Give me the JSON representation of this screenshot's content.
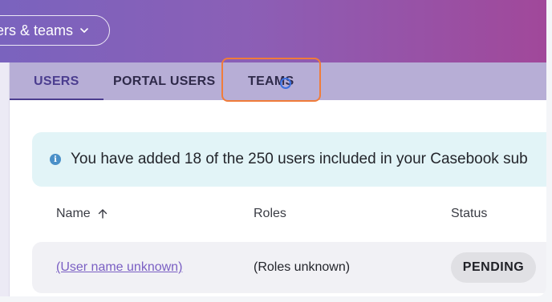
{
  "header": {
    "scope_selector_label": "ers & teams",
    "chevron_icon": "chevron-down-icon"
  },
  "tabs": [
    {
      "label": "USERS",
      "active": true
    },
    {
      "label": "PORTAL USERS",
      "active": false
    },
    {
      "label": "TEAMS",
      "active": false
    }
  ],
  "info_banner": {
    "icon": "info-icon",
    "icon_glyph": "i",
    "text": "You have added 18 of the 250 users included in your Casebook sub"
  },
  "table": {
    "columns": [
      {
        "label": "Name",
        "sort": "ascending"
      },
      {
        "label": "Roles"
      },
      {
        "label": "Status"
      }
    ],
    "rows": [
      {
        "name": "(User name unknown)",
        "roles": "(Roles unknown)",
        "status": "PENDING"
      }
    ]
  },
  "colors": {
    "header_gradient_start": "#7a63be",
    "header_gradient_end": "#a1489a",
    "tabbar": "#b7aed6",
    "highlight": "#f07c3a",
    "link": "#7a5fc3",
    "banner": "#e2f4f7"
  }
}
